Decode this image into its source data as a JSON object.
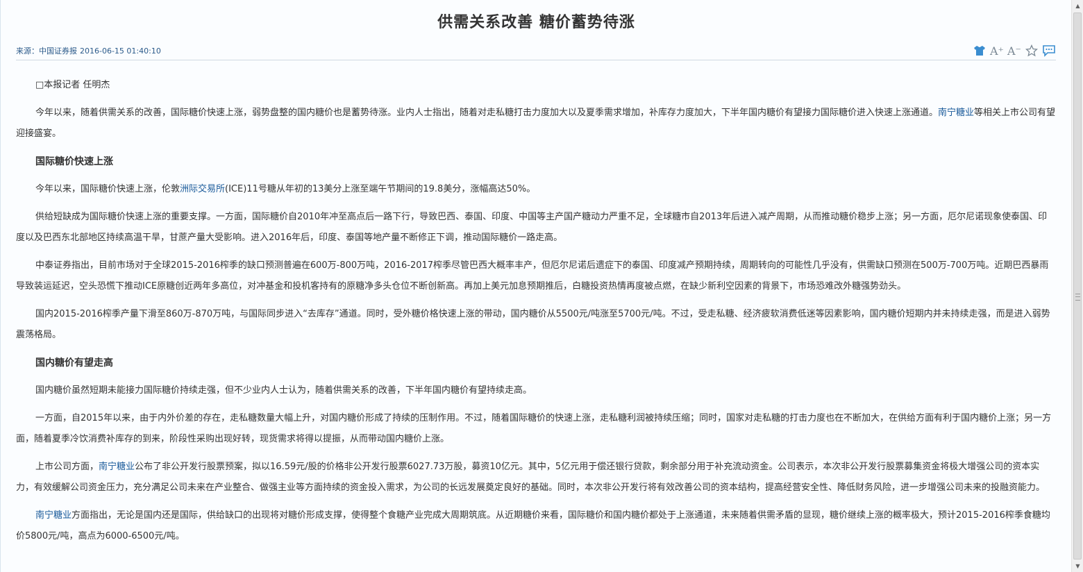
{
  "article": {
    "title": "供需关系改善 糖价蓄势待涨",
    "source_label": "来源：中国证券报",
    "date": "2016-06-15 01:40:10",
    "byline": "□本报记者 任明杰",
    "p1_a": "今年以来，随着供需关系的改善，国际糖价快速上涨，弱势盘整的国内糖价也是蓄势待涨。业内人士指出，随着对走私糖打击力度加大以及夏季需求增加，补库存力度加大，下半年国内糖价有望接力国际糖价进入快速上涨通道。",
    "p1_link": "南宁糖业",
    "p1_b": "等相关上市公司有望迎接盛宴。",
    "h1": "国际糖价快速上涨",
    "p2_a": "今年以来，国际糖价快速上涨，伦敦",
    "p2_link": "洲际交易所",
    "p2_b": "(ICE)11号糖从年初的13美分上涨至端午节期间的19.8美分，涨幅高达50%。",
    "p3": "供给短缺成为国际糖价快速上涨的重要支撑。一方面，国际糖价自2010年冲至高点后一路下行，导致巴西、泰国、印度、中国等主产国产糖动力严重不足，全球糖市自2013年后进入减产周期，从而推动糖价稳步上涨；另一方面，厄尔尼诺现象使泰国、印度以及巴西东北部地区持续高温干旱，甘蔗产量大受影响。进入2016年后，印度、泰国等地产量不断修正下调，推动国际糖价一路走高。",
    "p4": "中泰证券指出，目前市场对于全球2015-2016榨季的缺口预测普遍在600万-800万吨，2016-2017榨季尽管巴西大概率丰产，但厄尔尼诺后遗症下的泰国、印度减产预期持续，周期转向的可能性几乎没有，供需缺口预测在500万-700万吨。近期巴西暴雨导致装运延迟，空头恐慌下推动ICE原糖创近两年多高位，对冲基金和投机客持有的原糖净多头仓位不断创新高。再加上美元加息预期推后，白糖投资热情再度被点燃，在缺少新利空因素的背景下，市场恐难改外糖强势劲头。",
    "p5": "国内2015-2016榨季产量下滑至860万-870万吨，与国际同步进入“去库存”通道。同时，受外糖价格快速上涨的带动，国内糖价从5500元/吨涨至5700元/吨。不过，受走私糖、经济疲软消费低迷等因素影响，国内糖价短期内并未持续走强，而是进入弱势震荡格局。",
    "h2": "国内糖价有望走高",
    "p6": "国内糖价虽然短期未能接力国际糖价持续走强，但不少业内人士认为，随着供需关系的改善，下半年国内糖价有望持续走高。",
    "p7": "一方面，自2015年以来，由于内外价差的存在，走私糖数量大幅上升，对国内糖价形成了持续的压制作用。不过，随着国际糖价的快速上涨，走私糖利润被持续压缩；同时，国家对走私糖的打击力度也在不断加大，在供给方面有利于国内糖价上涨；另一方面，随着夏季冷饮消费补库存的到来，阶段性采购出现好转，现货需求将得以提振，从而带动国内糖价上涨。",
    "p8_a": "上市公司方面，",
    "p8_link": "南宁糖业",
    "p8_b": "公布了非公开发行股票预案，拟以16.59元/股的价格非公开发行股票6027.73万股，募资10亿元。其中，5亿元用于偿还银行贷款，剩余部分用于补充流动资金。公司表示，本次非公开发行股票募集资金将极大增强公司的资本实力，有效缓解公司资金压力，充分满足公司未来在产业整合、做强主业等方面持续的资金投入需求，为公司的长远发展奠定良好的基础。同时，本次非公开发行将有效改善公司的资本结构，提高经营安全性、降低财务风险，进一步增强公司未来的投融资能力。",
    "p9_link": "南宁糖业",
    "p9_b": "方面指出，无论是国内还是国际，供给缺口的出现将对糖价形成支撑，使得整个食糖产业完成大周期筑底。从近期糖价来看，国际糖价和国内糖价都处于上涨通道，未来随着供需矛盾的显现，糖价继续上涨的概率极大，预计2015-2016榨季食糖均价5800元/吨，高点为6000-6500元/吨。"
  },
  "toolbar": {
    "icons": [
      "shirt-icon",
      "font-increase-icon",
      "font-decrease-icon",
      "star-icon",
      "comment-icon"
    ],
    "font_increase_glyph": "A⁺",
    "font_decrease_glyph": "A⁻"
  },
  "colors": {
    "accent": "#3a8dd0",
    "link": "#1a5a9a",
    "text": "#333333"
  }
}
